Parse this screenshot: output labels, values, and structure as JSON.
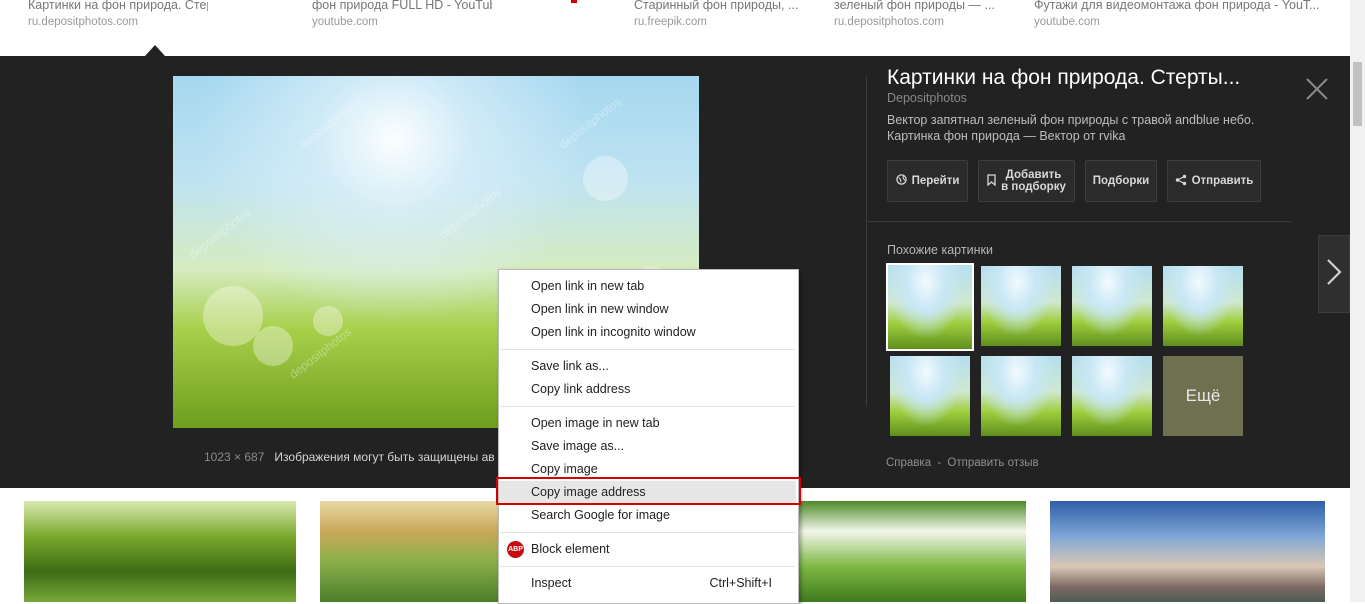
{
  "top_results": [
    {
      "title": "Картинки на фон природа. Стертый фон ...",
      "domain": "ru.depositphotos.com"
    },
    {
      "title": "фон природа FULL HD - YouTube",
      "domain": "youtube.com"
    },
    {
      "title": "Старинный фон природы, ...",
      "domain": "ru.freepik.com"
    },
    {
      "title": "зеленый фон природы — ...",
      "domain": "ru.depositphotos.com"
    },
    {
      "title": "Футажи для видеомонтажа фон природа - YouT...",
      "domain": "youtube.com"
    }
  ],
  "preview": {
    "title": "Картинки на фон природа. Стерты...",
    "source": "Depositphotos",
    "description": "Вектор запятнал зеленый фон природы с травой andblue небо. Картинка фон природа — Вектор от rvika",
    "dimensions": "1023 × 687",
    "notice": "Изображения могут быть защищены ав",
    "watermark": "depositphotos",
    "buttons": {
      "visit": "Перейти",
      "add_line1": "Добавить",
      "add_line2": "в подборку",
      "collections": "Подборки",
      "share": "Отправить"
    },
    "similar_label": "Похожие картинки",
    "more_label": "Ещё",
    "help_link": "Справка",
    "separator": "-",
    "feedback_link": "Отправить отзыв"
  },
  "context_menu": {
    "items": [
      "Open link in new tab",
      "Open link in new window",
      "Open link in incognito window",
      "Save link as...",
      "Copy link address",
      "Open image in new tab",
      "Save image as...",
      "Copy image",
      "Copy image address",
      "Search Google for image",
      "Block element",
      "Inspect"
    ],
    "inspect_shortcut": "Ctrl+Shift+I",
    "highlighted": "Copy image address",
    "abp_icon_text": "ABP"
  },
  "colors": {
    "panel_bg": "#222222",
    "highlight_box": "#d40000",
    "menu_bg": "#ffffff"
  }
}
